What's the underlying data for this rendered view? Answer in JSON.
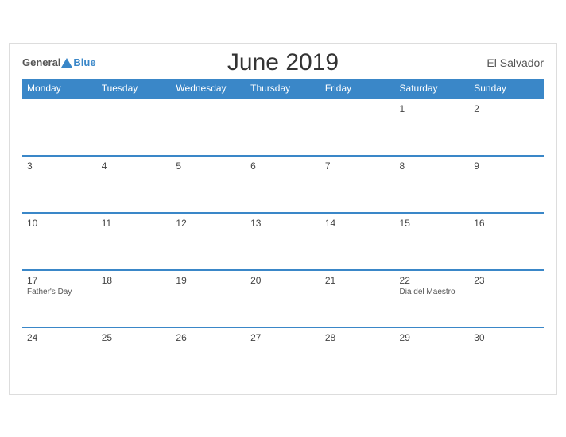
{
  "header": {
    "title": "June 2019",
    "country": "El Salvador",
    "logo_general": "General",
    "logo_blue": "Blue"
  },
  "weekdays": [
    "Monday",
    "Tuesday",
    "Wednesday",
    "Thursday",
    "Friday",
    "Saturday",
    "Sunday"
  ],
  "weeks": [
    [
      {
        "day": "",
        "empty": true
      },
      {
        "day": "",
        "empty": true
      },
      {
        "day": "",
        "empty": true
      },
      {
        "day": "",
        "empty": true
      },
      {
        "day": "",
        "empty": true
      },
      {
        "day": "1",
        "empty": false,
        "holiday": ""
      },
      {
        "day": "2",
        "empty": false,
        "holiday": ""
      }
    ],
    [
      {
        "day": "3",
        "empty": false,
        "holiday": ""
      },
      {
        "day": "4",
        "empty": false,
        "holiday": ""
      },
      {
        "day": "5",
        "empty": false,
        "holiday": ""
      },
      {
        "day": "6",
        "empty": false,
        "holiday": ""
      },
      {
        "day": "7",
        "empty": false,
        "holiday": ""
      },
      {
        "day": "8",
        "empty": false,
        "holiday": ""
      },
      {
        "day": "9",
        "empty": false,
        "holiday": ""
      }
    ],
    [
      {
        "day": "10",
        "empty": false,
        "holiday": ""
      },
      {
        "day": "11",
        "empty": false,
        "holiday": ""
      },
      {
        "day": "12",
        "empty": false,
        "holiday": ""
      },
      {
        "day": "13",
        "empty": false,
        "holiday": ""
      },
      {
        "day": "14",
        "empty": false,
        "holiday": ""
      },
      {
        "day": "15",
        "empty": false,
        "holiday": ""
      },
      {
        "day": "16",
        "empty": false,
        "holiday": ""
      }
    ],
    [
      {
        "day": "17",
        "empty": false,
        "holiday": "Father's Day"
      },
      {
        "day": "18",
        "empty": false,
        "holiday": ""
      },
      {
        "day": "19",
        "empty": false,
        "holiday": ""
      },
      {
        "day": "20",
        "empty": false,
        "holiday": ""
      },
      {
        "day": "21",
        "empty": false,
        "holiday": ""
      },
      {
        "day": "22",
        "empty": false,
        "holiday": "Dia del Maestro"
      },
      {
        "day": "23",
        "empty": false,
        "holiday": ""
      }
    ],
    [
      {
        "day": "24",
        "empty": false,
        "holiday": ""
      },
      {
        "day": "25",
        "empty": false,
        "holiday": ""
      },
      {
        "day": "26",
        "empty": false,
        "holiday": ""
      },
      {
        "day": "27",
        "empty": false,
        "holiday": ""
      },
      {
        "day": "28",
        "empty": false,
        "holiday": ""
      },
      {
        "day": "29",
        "empty": false,
        "holiday": ""
      },
      {
        "day": "30",
        "empty": false,
        "holiday": ""
      }
    ]
  ]
}
